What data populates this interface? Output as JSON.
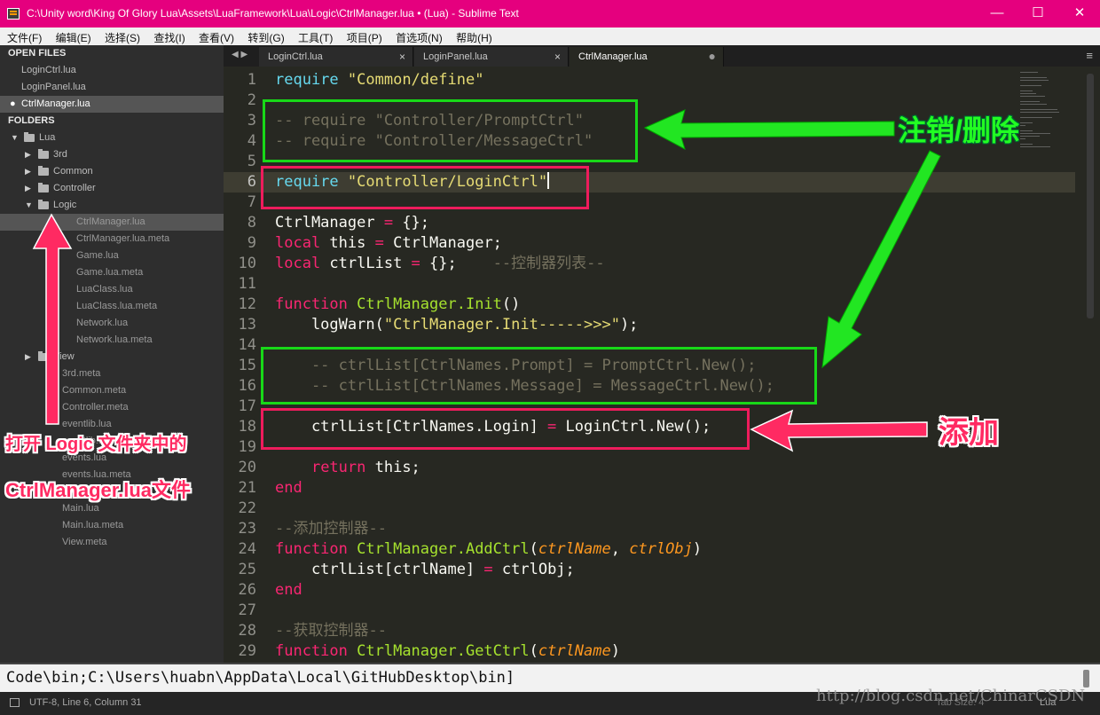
{
  "window": {
    "title": "C:\\Unity word\\King Of Glory Lua\\Assets\\LuaFramework\\Lua\\Logic\\CtrlManager.lua • (Lua) - Sublime Text",
    "minimize": "—",
    "maximize": "☐",
    "close": "✕"
  },
  "menu": [
    "文件(F)",
    "编辑(E)",
    "选择(S)",
    "查找(I)",
    "查看(V)",
    "转到(G)",
    "工具(T)",
    "项目(P)",
    "首选项(N)",
    "帮助(H)"
  ],
  "sidebar": {
    "open_files_header": "OPEN FILES",
    "open_files": [
      {
        "label": "LoginCtrl.lua",
        "active": false
      },
      {
        "label": "LoginPanel.lua",
        "active": false
      },
      {
        "label": "CtrlManager.lua",
        "active": true,
        "marker": "●"
      }
    ],
    "folders_header": "FOLDERS",
    "tree": [
      {
        "label": "Lua",
        "type": "folder",
        "depth": 0,
        "expanded": true
      },
      {
        "label": "3rd",
        "type": "folder",
        "depth": 1,
        "expanded": false
      },
      {
        "label": "Common",
        "type": "folder",
        "depth": 1,
        "expanded": false
      },
      {
        "label": "Controller",
        "type": "folder",
        "depth": 1,
        "expanded": false
      },
      {
        "label": "Logic",
        "type": "folder",
        "depth": 1,
        "expanded": true
      },
      {
        "label": "CtrlManager.lua",
        "type": "file",
        "depth": 2,
        "selected": true
      },
      {
        "label": "CtrlManager.lua.meta",
        "type": "file",
        "depth": 2
      },
      {
        "label": "Game.lua",
        "type": "file",
        "depth": 2
      },
      {
        "label": "Game.lua.meta",
        "type": "file",
        "depth": 2
      },
      {
        "label": "LuaClass.lua",
        "type": "file",
        "depth": 2
      },
      {
        "label": "LuaClass.lua.meta",
        "type": "file",
        "depth": 2
      },
      {
        "label": "Network.lua",
        "type": "file",
        "depth": 2
      },
      {
        "label": "Network.lua.meta",
        "type": "file",
        "depth": 2
      },
      {
        "label": "View",
        "type": "folder",
        "depth": 1,
        "expanded": false
      },
      {
        "label": "3rd.meta",
        "type": "file",
        "depth": 1
      },
      {
        "label": "Common.meta",
        "type": "file",
        "depth": 1
      },
      {
        "label": "Controller.meta",
        "type": "file",
        "depth": 1
      },
      {
        "label": "eventlib.lua",
        "type": "file",
        "depth": 1
      },
      {
        "label": "eventlib.lua.meta",
        "type": "file",
        "depth": 1
      },
      {
        "label": "events.lua",
        "type": "file",
        "depth": 1
      },
      {
        "label": "events.lua.meta",
        "type": "file",
        "depth": 1
      },
      {
        "label": "Logic.meta",
        "type": "file",
        "depth": 1
      },
      {
        "label": "Main.lua",
        "type": "file",
        "depth": 1
      },
      {
        "label": "Main.lua.meta",
        "type": "file",
        "depth": 1
      },
      {
        "label": "View.meta",
        "type": "file",
        "depth": 1
      }
    ]
  },
  "tabs": [
    {
      "label": "LoginCtrl.lua",
      "close": "×",
      "active": false
    },
    {
      "label": "LoginPanel.lua",
      "close": "×",
      "active": false
    },
    {
      "label": "CtrlManager.lua",
      "close": "●",
      "active": true
    }
  ],
  "tab_nav": "◀ ▶",
  "tab_menu": "≡",
  "editor": {
    "current_line": 6,
    "lines": [
      [
        [
          "b",
          "require"
        ],
        [
          "",
          " "
        ],
        [
          "s",
          "\"Common/define\""
        ]
      ],
      [],
      [
        [
          "c",
          "-- require \"Controller/PromptCtrl\""
        ]
      ],
      [
        [
          "c",
          "-- require \"Controller/MessageCtrl\""
        ]
      ],
      [],
      [
        [
          "b",
          "require"
        ],
        [
          "",
          " "
        ],
        [
          "s",
          "\"Controller/LoginCtrl\""
        ]
      ],
      [],
      [
        [
          "",
          "CtrlManager "
        ],
        [
          "k",
          "="
        ],
        [
          "",
          " {};"
        ]
      ],
      [
        [
          "k",
          "local"
        ],
        [
          "",
          " this "
        ],
        [
          "k",
          "="
        ],
        [
          "",
          " CtrlManager;"
        ]
      ],
      [
        [
          "k",
          "local"
        ],
        [
          "",
          " ctrlList "
        ],
        [
          "k",
          "="
        ],
        [
          "",
          " {};    "
        ],
        [
          "c",
          "--控制器列表--"
        ]
      ],
      [],
      [
        [
          "k",
          "function"
        ],
        [
          "",
          " "
        ],
        [
          "f",
          "CtrlManager.Init"
        ],
        [
          "",
          "()"
        ]
      ],
      [
        [
          "",
          "    logWarn("
        ],
        [
          "s",
          "\"CtrlManager.Init----->>>\""
        ],
        [
          "",
          ");"
        ]
      ],
      [],
      [
        [
          "c",
          "    -- ctrlList[CtrlNames.Prompt] = PromptCtrl.New();"
        ]
      ],
      [
        [
          "c",
          "    -- ctrlList[CtrlNames.Message] = MessageCtrl.New();"
        ]
      ],
      [],
      [
        [
          "",
          "    ctrlList[CtrlNames.Login] "
        ],
        [
          "k",
          "="
        ],
        [
          "",
          " LoginCtrl.New();"
        ]
      ],
      [],
      [
        [
          "",
          "    "
        ],
        [
          "k",
          "return"
        ],
        [
          "",
          " this;"
        ]
      ],
      [
        [
          "k",
          "end"
        ]
      ],
      [],
      [
        [
          "c",
          "--添加控制器--"
        ]
      ],
      [
        [
          "k",
          "function"
        ],
        [
          "",
          " "
        ],
        [
          "f",
          "CtrlManager.AddCtrl"
        ],
        [
          "",
          "("
        ],
        [
          "p",
          "ctrlName"
        ],
        [
          "",
          ", "
        ],
        [
          "p",
          "ctrlObj"
        ],
        [
          "",
          ")"
        ]
      ],
      [
        [
          "",
          "    ctrlList[ctrlName] "
        ],
        [
          "k",
          "="
        ],
        [
          "",
          " ctrlObj;"
        ]
      ],
      [
        [
          "k",
          "end"
        ]
      ],
      [],
      [
        [
          "c",
          "--获取控制器--"
        ]
      ],
      [
        [
          "k",
          "function"
        ],
        [
          "",
          " "
        ],
        [
          "f",
          "CtrlManager.GetCtrl"
        ],
        [
          "",
          "("
        ],
        [
          "p",
          "ctrlName"
        ],
        [
          "",
          ")"
        ]
      ]
    ]
  },
  "console": {
    "text": "Code\\bin;C:\\Users\\huabn\\AppData\\Local\\GitHubDesktop\\bin]"
  },
  "status": {
    "position": "UTF-8, Line 6, Column 31",
    "tab_size": "Tab Size: 4",
    "syntax": "Lua"
  },
  "watermark": "http://blog.csdn.net/ChinarCSDN",
  "annotations": {
    "comment_out": "注销/删除",
    "add": "添加",
    "open_file_line1": "打开 Logic 文件夹中的",
    "open_file_line2": "CtrlManager.lua文件"
  },
  "colors": {
    "title_bar": "#e5007e",
    "editor_bg": "#272822",
    "annotation_green": "#18d818",
    "annotation_pink": "#ee1c5c"
  }
}
